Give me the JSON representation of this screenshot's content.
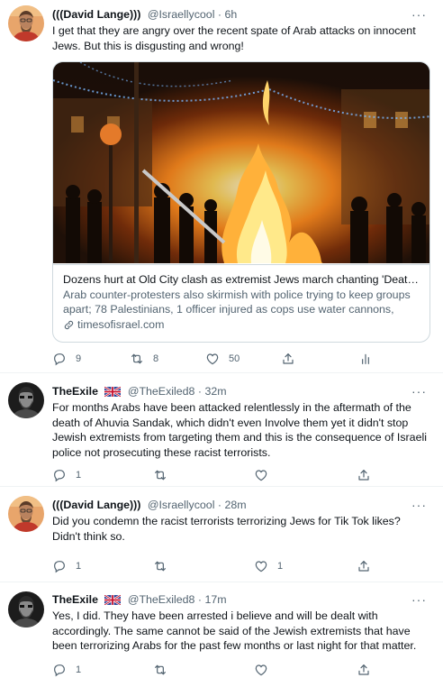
{
  "colors": {
    "text": "#0f1419",
    "secondary": "#536471",
    "border": "#cfd9de",
    "divider": "#eff3f4"
  },
  "tweets": [
    {
      "name": "(((David Lange)))",
      "handle": "@Israellycool",
      "separator": "·",
      "time": "6h",
      "more": "···",
      "avatar_icon": "avatar-photo-icon",
      "text": "I get that they are angry over the recent spate of Arab attacks on innocent Jews. But this is disgusting and wrong!",
      "card": {
        "title": "Dozens hurt at Old City clash as extremist Jews march chanting 'Death ...",
        "description": "Arab counter-protesters also skirmish with police trying to keep groups apart; 78 Palestinians, 1 officer injured as cops use water cannons, stun...",
        "domain": "timesofisrael.com",
        "image_icon": "fire-photo-icon"
      },
      "actions": {
        "replies": "9",
        "retweets": "8",
        "likes": "50",
        "share": "",
        "analytics": ""
      }
    },
    {
      "name": "TheExile",
      "flag_icon": "uk-flag-icon",
      "handle": "@TheExiled8",
      "separator": "·",
      "time": "32m",
      "more": "···",
      "text": "For months Arabs have been attacked relentlessly in the aftermath of the death of Ahuvia Sandak, which didn't even Involve them yet it didn't stop Jewish extremists from targeting them and this is the consequence of Israeli police not prosecuting these racist terrorists.",
      "actions": {
        "replies": "1",
        "retweets": "",
        "likes": ""
      }
    },
    {
      "name": "(((David Lange)))",
      "handle": "@Israellycool",
      "separator": "·",
      "time": "28m",
      "more": "···",
      "text": "Did you condemn the racist terrorists terrorizing Jews for Tik Tok likes? Didn't think so.",
      "actions": {
        "replies": "1",
        "retweets": "",
        "likes": "1"
      }
    },
    {
      "name": "TheExile",
      "flag_icon": "uk-flag-icon",
      "handle": "@TheExiled8",
      "separator": "·",
      "time": "17m",
      "more": "···",
      "text": "Yes, I did. They have been arrested i believe and will be dealt with accordingly. The same cannot be said of the Jewish extremists that have been terrorizing Arabs for the past few months or last night for that matter.",
      "actions": {
        "replies": "1",
        "retweets": "",
        "likes": ""
      }
    }
  ]
}
